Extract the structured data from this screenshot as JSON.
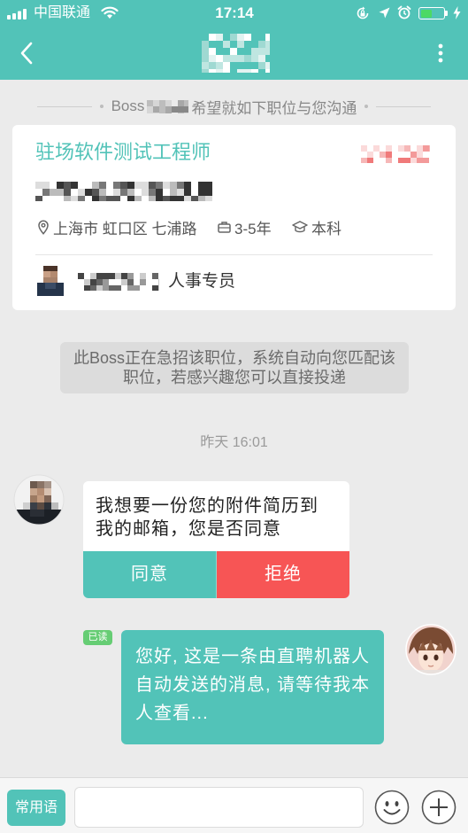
{
  "status_bar": {
    "carrier": "中国联通",
    "time": "17:14",
    "battery_level": 0.5,
    "icons": [
      "signal-icon",
      "wifi-icon",
      "rotation-lock-icon",
      "location-arrow-icon",
      "alarm-icon",
      "battery-icon",
      "charging-icon"
    ]
  },
  "nav": {
    "icons": [
      "chevron-left-icon",
      "more-vertical-icon"
    ]
  },
  "intro": {
    "prefix": "Boss",
    "suffix": "希望就如下职位与您沟通"
  },
  "job_card": {
    "title": "驻场软件测试工程师",
    "location": "上海市 虹口区 七浦路",
    "experience": "3-5年",
    "education": "本科",
    "recruiter_role": "人事专员",
    "icons": [
      "location-pin-icon",
      "briefcase-icon",
      "graduation-cap-icon"
    ]
  },
  "system_notice": {
    "text": "此Boss正在急招该职位，系统自动向您匹配该职位，若感兴趣您可以直接投递"
  },
  "chat": {
    "timestamp": "昨天 16:01",
    "incoming": {
      "text": "我想要一份您的附件简历到我的邮箱，您是否同意",
      "accept_label": "同意",
      "reject_label": "拒绝"
    },
    "outgoing": {
      "read_status": "已读",
      "text": "您好, 这是一条由直聘机器人自动发送的消息, 请等待我本人查看..."
    }
  },
  "input_bar": {
    "phrases_label": "常用语",
    "message_value": "",
    "icons": [
      "emoji-icon",
      "plus-icon"
    ]
  },
  "colors": {
    "accent": "#52c3b8",
    "reject": "#f75555",
    "read_badge": "#66cd74",
    "background": "#ebebeb",
    "card": "#ffffff"
  }
}
